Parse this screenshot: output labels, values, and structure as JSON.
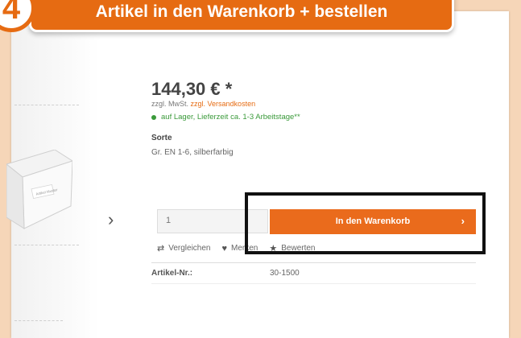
{
  "header": {
    "step": "4",
    "title": "Artikel in den Warenkorb + bestellen"
  },
  "gallery": {
    "next_icon": "chevron-right-icon",
    "box_label": "Artikel Muster"
  },
  "product": {
    "price": "144,30 € *",
    "tax_text": "zzgl. MwSt.",
    "shipping_link": "zzgl. Versandkosten",
    "stock": "auf Lager, Lieferzeit ca. 1-3 Arbeitstage**",
    "variant_label": "Sorte",
    "variant_value": "Gr. EN 1-6, silberfarbig",
    "quantity": "1",
    "cart_button": "In den Warenkorb",
    "cart_button_icon": "chevron-right-icon",
    "actions": [
      {
        "label": "Vergleichen",
        "icon": "compare-icon"
      },
      {
        "label": "Merken",
        "icon": "heart-icon"
      },
      {
        "label": "Bewerten",
        "icon": "star-icon"
      }
    ],
    "article_label": "Artikel-Nr.:",
    "article_value": "30-1500"
  },
  "colors": {
    "accent": "#e66b12",
    "stock_green": "#3a9a3a",
    "page_bg": "#f6d6b8"
  }
}
